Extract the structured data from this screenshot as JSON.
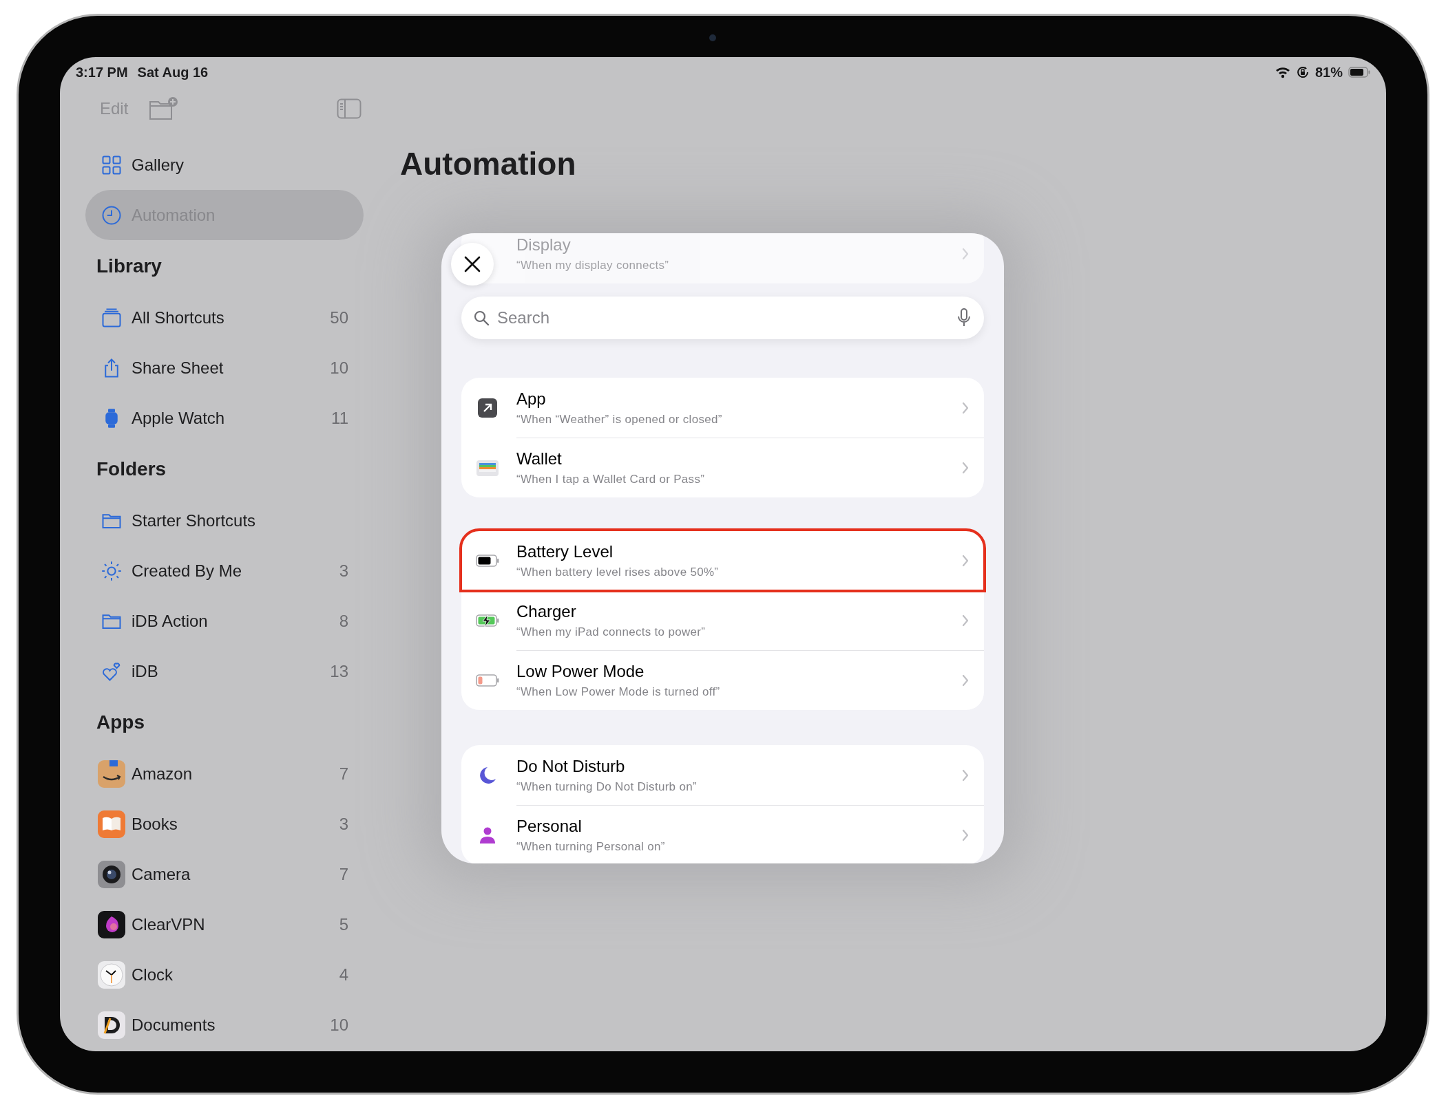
{
  "status_bar": {
    "time": "3:17 PM",
    "date": "Sat Aug 16",
    "battery_percent": "81%"
  },
  "sidebar": {
    "toolbar": {
      "edit": "Edit"
    },
    "items": [
      {
        "label": "Gallery",
        "selected": false
      },
      {
        "label": "Automation",
        "selected": true
      }
    ],
    "sections": [
      {
        "title": "Library",
        "items": [
          {
            "label": "All Shortcuts",
            "count": "50",
            "selected": false
          },
          {
            "label": "Share Sheet",
            "count": "10",
            "selected": false
          },
          {
            "label": "Apple Watch",
            "count": "11",
            "selected": false
          }
        ]
      },
      {
        "title": "Folders",
        "items": [
          {
            "label": "Starter Shortcuts",
            "selected": false
          },
          {
            "label": "Created By Me",
            "count": "3",
            "selected": false
          },
          {
            "label": "iDB Action",
            "count": "8",
            "selected": false
          },
          {
            "label": "iDB",
            "count": "13",
            "selected": false
          }
        ]
      },
      {
        "title": "Apps",
        "items": [
          {
            "label": "Amazon",
            "count": "7",
            "selected": false
          },
          {
            "label": "Books",
            "count": "3",
            "selected": false
          },
          {
            "label": "Camera",
            "count": "7",
            "selected": false
          },
          {
            "label": "ClearVPN",
            "count": "5",
            "selected": false
          },
          {
            "label": "Clock",
            "count": "4",
            "selected": false
          },
          {
            "label": "Documents",
            "count": "10",
            "selected": false
          }
        ]
      }
    ]
  },
  "page_title": "Automation",
  "sheet": {
    "scrolled_under": [
      {
        "title": "Display",
        "subtitle": "“When my display connects”"
      }
    ],
    "search": {
      "placeholder": "Search"
    },
    "groups": [
      {
        "rows": [
          {
            "title": "App",
            "subtitle": "“When “Weather” is opened or closed”",
            "highlighted": false
          },
          {
            "title": "Wallet",
            "subtitle": "“When I tap a Wallet Card or Pass”",
            "highlighted": false
          }
        ]
      },
      {
        "rows": [
          {
            "title": "Battery Level",
            "subtitle": "“When battery level rises above 50%”",
            "highlighted": true
          },
          {
            "title": "Charger",
            "subtitle": "“When my iPad connects to power”",
            "highlighted": false
          },
          {
            "title": "Low Power Mode",
            "subtitle": "“When Low Power Mode is turned off”",
            "highlighted": false
          }
        ]
      },
      {
        "rows": [
          {
            "title": "Do Not Disturb",
            "subtitle": "“When turning Do Not Disturb on”",
            "highlighted": false
          },
          {
            "title": "Personal",
            "subtitle": "“When turning Personal on”",
            "highlighted": false
          }
        ]
      }
    ]
  }
}
